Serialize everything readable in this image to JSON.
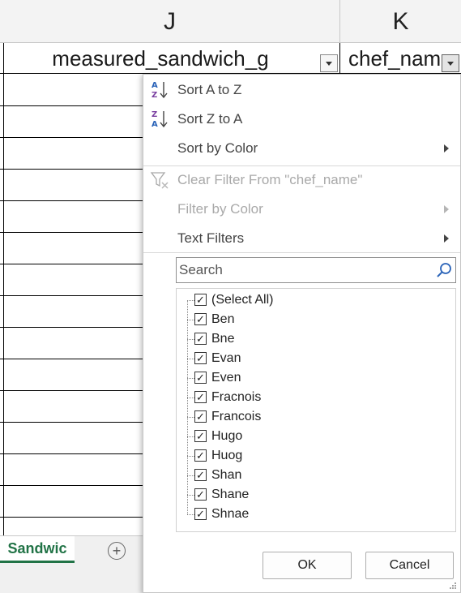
{
  "columns": {
    "j_header": "J",
    "k_header": "K"
  },
  "header_cells": {
    "j": "measured_sandwich_g",
    "k": "chef_nam"
  },
  "sheet_tabs": {
    "active": "Sandwic",
    "add_symbol": "+"
  },
  "filter_menu": {
    "sort_az": "Sort A to Z",
    "sort_za": "Sort Z to A",
    "sort_by_color": "Sort by Color",
    "clear_filter": "Clear Filter From \"chef_name\"",
    "filter_by_color": "Filter by Color",
    "text_filters": "Text Filters",
    "search_placeholder": "Search",
    "items": [
      {
        "label": "(Select All)",
        "checked": true
      },
      {
        "label": "Ben",
        "checked": true
      },
      {
        "label": "Bne",
        "checked": true
      },
      {
        "label": "Evan",
        "checked": true
      },
      {
        "label": "Even",
        "checked": true
      },
      {
        "label": "Fracnois",
        "checked": true
      },
      {
        "label": "Francois",
        "checked": true
      },
      {
        "label": "Hugo",
        "checked": true
      },
      {
        "label": "Huog",
        "checked": true
      },
      {
        "label": "Shan",
        "checked": true
      },
      {
        "label": "Shane",
        "checked": true
      },
      {
        "label": "Shnae",
        "checked": true
      }
    ],
    "ok_label": "OK",
    "cancel_label": "Cancel"
  },
  "colors": {
    "accent": "#217346",
    "sort_icon_blue": "#2a63b8",
    "sort_icon_purple": "#7a3fa0",
    "disabled_text": "#a9a9a9"
  }
}
